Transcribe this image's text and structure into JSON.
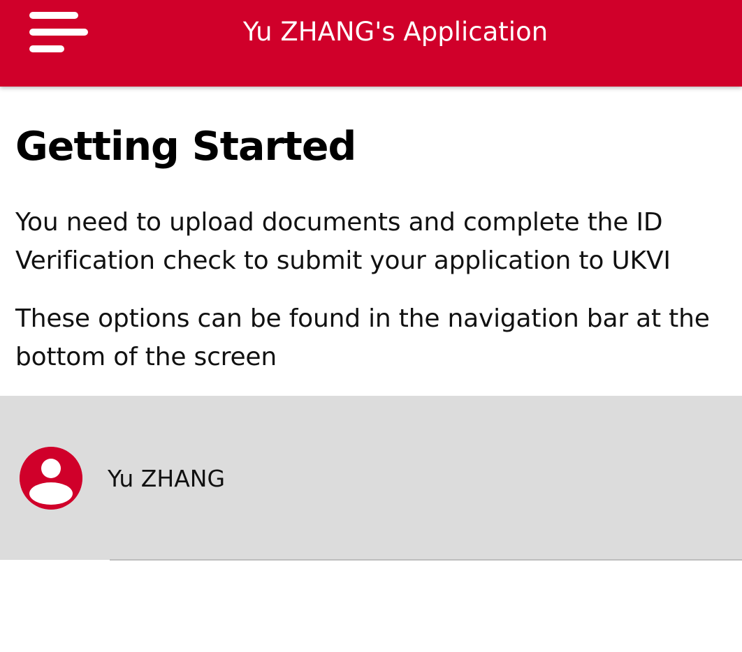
{
  "header": {
    "title": "Yu ZHANG's Application",
    "menu_icon": "hamburger-menu-icon",
    "background_color": "#d0002a",
    "text_color": "#ffffff"
  },
  "main": {
    "title": "Getting Started",
    "paragraphs": [
      "You need to upload documents and complete the ID Verification check to submit your application to UKVI",
      "These options can be found in the navigation bar at the bottom of the screen"
    ]
  },
  "profile": {
    "name": "Yu ZHANG",
    "avatar_icon": "user-avatar-icon",
    "avatar_color": "#d0002a",
    "panel_color": "#dcdcdc"
  }
}
